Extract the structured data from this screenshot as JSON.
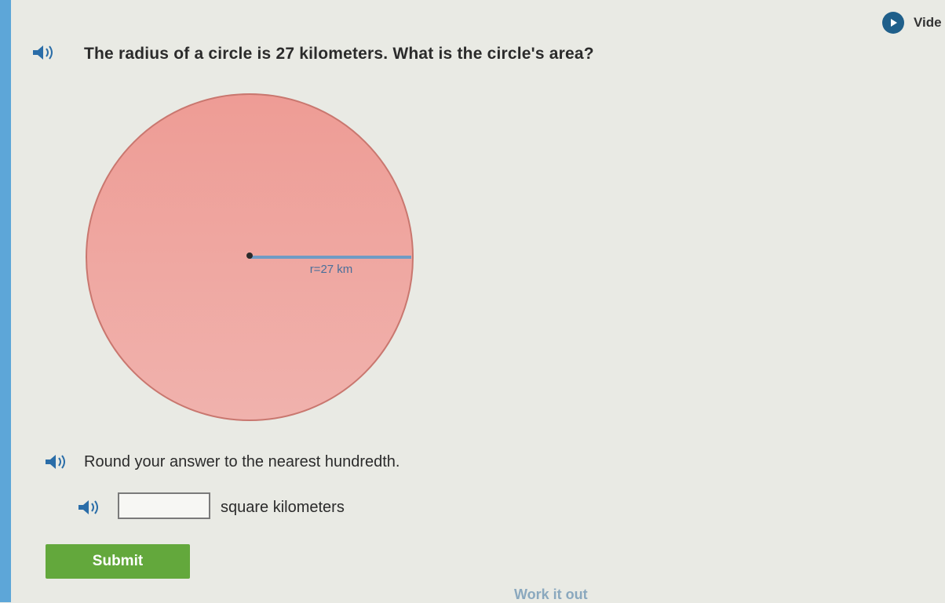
{
  "question": {
    "text": "The radius of a circle is 27 kilometers. What is the circle's area?"
  },
  "video_button": {
    "label": "Vide"
  },
  "figure": {
    "radius_label": "r=27 km",
    "fill_color": "#ed9e98",
    "border_color": "#c9776f",
    "radius_line_color": "#6f9bc4"
  },
  "instruction": {
    "text": "Round your answer to the nearest hundredth."
  },
  "answer": {
    "value": "",
    "unit": "square kilometers"
  },
  "submit": {
    "label": "Submit"
  },
  "work_it_out": {
    "label": "Work it out"
  },
  "colors": {
    "left_strip": "#5da6d8",
    "submit_green": "#63a83c",
    "speaker_blue": "#2a6da8"
  }
}
